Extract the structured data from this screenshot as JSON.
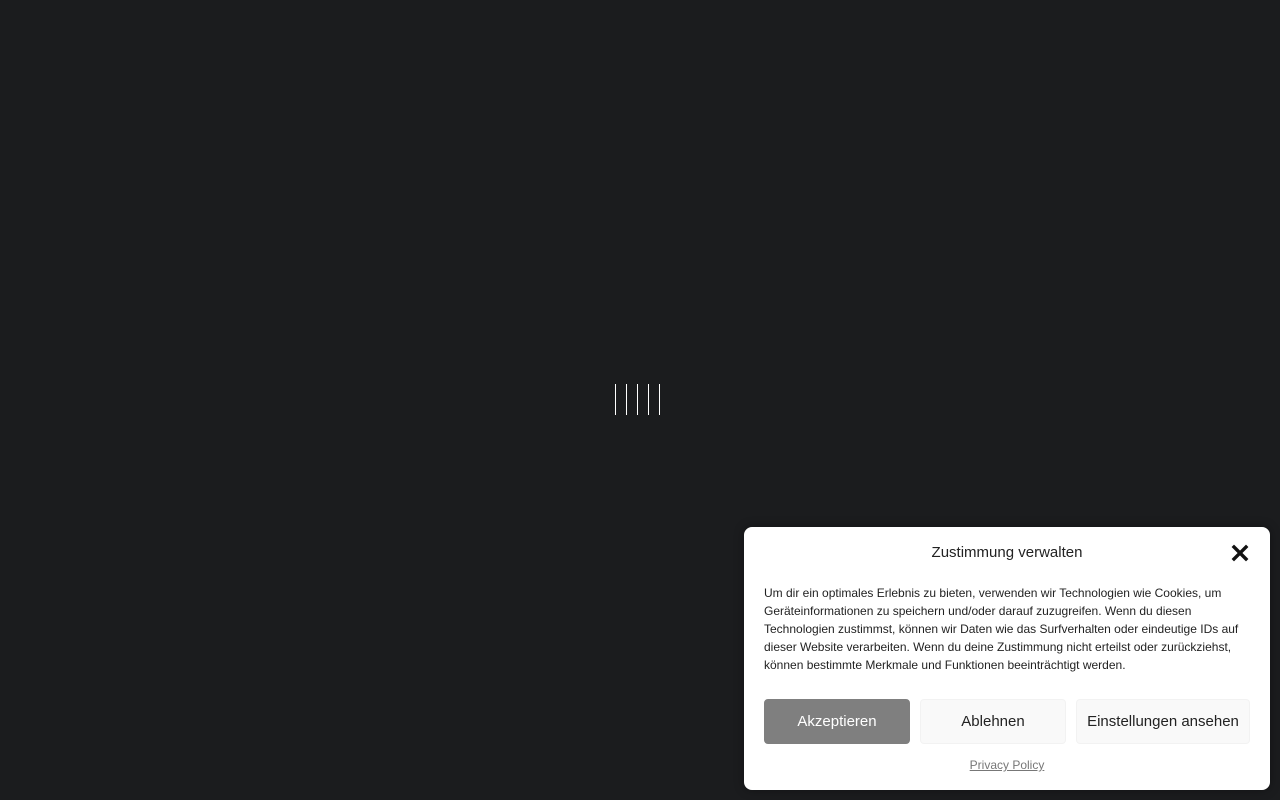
{
  "loader": {
    "bar_count": 5,
    "color": "#ffffff"
  },
  "consent": {
    "title": "Zustimmung verwalten",
    "close_icon": "close-icon",
    "message": "Um dir ein optimales Erlebnis zu bieten, verwenden wir Technologien wie Cookies, um Geräteinformationen zu speichern und/oder darauf zuzugreifen. Wenn du diesen Technologien zustimmst, können wir Daten wie das Surfverhalten oder eindeutige IDs auf dieser Website verarbeiten. Wenn du deine Zustimmung nicht erteilst oder zurückziehst, können bestimmte Merkmale und Funktionen beeinträchtigt werden.",
    "accept_label": "Akzeptieren",
    "deny_label": "Ablehnen",
    "preferences_label": "Einstellungen ansehen",
    "privacy_link": "Privacy Policy"
  },
  "colors": {
    "page_background": "#1b1c1e",
    "accept_button": "#7f7f7f",
    "secondary_button": "#f9f9f9",
    "dialog_background": "#ffffff"
  }
}
